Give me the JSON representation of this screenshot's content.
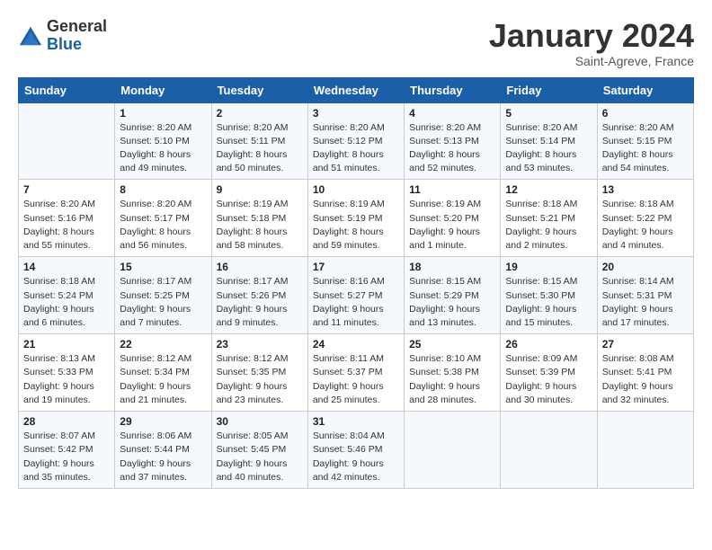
{
  "header": {
    "logo": {
      "general": "General",
      "blue": "Blue"
    },
    "title": "January 2024",
    "location": "Saint-Agreve, France"
  },
  "weekdays": [
    "Sunday",
    "Monday",
    "Tuesday",
    "Wednesday",
    "Thursday",
    "Friday",
    "Saturday"
  ],
  "weeks": [
    [
      {
        "day": null,
        "sunrise": null,
        "sunset": null,
        "daylight": null
      },
      {
        "day": "1",
        "sunrise": "Sunrise: 8:20 AM",
        "sunset": "Sunset: 5:10 PM",
        "daylight": "Daylight: 8 hours and 49 minutes."
      },
      {
        "day": "2",
        "sunrise": "Sunrise: 8:20 AM",
        "sunset": "Sunset: 5:11 PM",
        "daylight": "Daylight: 8 hours and 50 minutes."
      },
      {
        "day": "3",
        "sunrise": "Sunrise: 8:20 AM",
        "sunset": "Sunset: 5:12 PM",
        "daylight": "Daylight: 8 hours and 51 minutes."
      },
      {
        "day": "4",
        "sunrise": "Sunrise: 8:20 AM",
        "sunset": "Sunset: 5:13 PM",
        "daylight": "Daylight: 8 hours and 52 minutes."
      },
      {
        "day": "5",
        "sunrise": "Sunrise: 8:20 AM",
        "sunset": "Sunset: 5:14 PM",
        "daylight": "Daylight: 8 hours and 53 minutes."
      },
      {
        "day": "6",
        "sunrise": "Sunrise: 8:20 AM",
        "sunset": "Sunset: 5:15 PM",
        "daylight": "Daylight: 8 hours and 54 minutes."
      }
    ],
    [
      {
        "day": "7",
        "sunrise": "Sunrise: 8:20 AM",
        "sunset": "Sunset: 5:16 PM",
        "daylight": "Daylight: 8 hours and 55 minutes."
      },
      {
        "day": "8",
        "sunrise": "Sunrise: 8:20 AM",
        "sunset": "Sunset: 5:17 PM",
        "daylight": "Daylight: 8 hours and 56 minutes."
      },
      {
        "day": "9",
        "sunrise": "Sunrise: 8:19 AM",
        "sunset": "Sunset: 5:18 PM",
        "daylight": "Daylight: 8 hours and 58 minutes."
      },
      {
        "day": "10",
        "sunrise": "Sunrise: 8:19 AM",
        "sunset": "Sunset: 5:19 PM",
        "daylight": "Daylight: 8 hours and 59 minutes."
      },
      {
        "day": "11",
        "sunrise": "Sunrise: 8:19 AM",
        "sunset": "Sunset: 5:20 PM",
        "daylight": "Daylight: 9 hours and 1 minute."
      },
      {
        "day": "12",
        "sunrise": "Sunrise: 8:18 AM",
        "sunset": "Sunset: 5:21 PM",
        "daylight": "Daylight: 9 hours and 2 minutes."
      },
      {
        "day": "13",
        "sunrise": "Sunrise: 8:18 AM",
        "sunset": "Sunset: 5:22 PM",
        "daylight": "Daylight: 9 hours and 4 minutes."
      }
    ],
    [
      {
        "day": "14",
        "sunrise": "Sunrise: 8:18 AM",
        "sunset": "Sunset: 5:24 PM",
        "daylight": "Daylight: 9 hours and 6 minutes."
      },
      {
        "day": "15",
        "sunrise": "Sunrise: 8:17 AM",
        "sunset": "Sunset: 5:25 PM",
        "daylight": "Daylight: 9 hours and 7 minutes."
      },
      {
        "day": "16",
        "sunrise": "Sunrise: 8:17 AM",
        "sunset": "Sunset: 5:26 PM",
        "daylight": "Daylight: 9 hours and 9 minutes."
      },
      {
        "day": "17",
        "sunrise": "Sunrise: 8:16 AM",
        "sunset": "Sunset: 5:27 PM",
        "daylight": "Daylight: 9 hours and 11 minutes."
      },
      {
        "day": "18",
        "sunrise": "Sunrise: 8:15 AM",
        "sunset": "Sunset: 5:29 PM",
        "daylight": "Daylight: 9 hours and 13 minutes."
      },
      {
        "day": "19",
        "sunrise": "Sunrise: 8:15 AM",
        "sunset": "Sunset: 5:30 PM",
        "daylight": "Daylight: 9 hours and 15 minutes."
      },
      {
        "day": "20",
        "sunrise": "Sunrise: 8:14 AM",
        "sunset": "Sunset: 5:31 PM",
        "daylight": "Daylight: 9 hours and 17 minutes."
      }
    ],
    [
      {
        "day": "21",
        "sunrise": "Sunrise: 8:13 AM",
        "sunset": "Sunset: 5:33 PM",
        "daylight": "Daylight: 9 hours and 19 minutes."
      },
      {
        "day": "22",
        "sunrise": "Sunrise: 8:12 AM",
        "sunset": "Sunset: 5:34 PM",
        "daylight": "Daylight: 9 hours and 21 minutes."
      },
      {
        "day": "23",
        "sunrise": "Sunrise: 8:12 AM",
        "sunset": "Sunset: 5:35 PM",
        "daylight": "Daylight: 9 hours and 23 minutes."
      },
      {
        "day": "24",
        "sunrise": "Sunrise: 8:11 AM",
        "sunset": "Sunset: 5:37 PM",
        "daylight": "Daylight: 9 hours and 25 minutes."
      },
      {
        "day": "25",
        "sunrise": "Sunrise: 8:10 AM",
        "sunset": "Sunset: 5:38 PM",
        "daylight": "Daylight: 9 hours and 28 minutes."
      },
      {
        "day": "26",
        "sunrise": "Sunrise: 8:09 AM",
        "sunset": "Sunset: 5:39 PM",
        "daylight": "Daylight: 9 hours and 30 minutes."
      },
      {
        "day": "27",
        "sunrise": "Sunrise: 8:08 AM",
        "sunset": "Sunset: 5:41 PM",
        "daylight": "Daylight: 9 hours and 32 minutes."
      }
    ],
    [
      {
        "day": "28",
        "sunrise": "Sunrise: 8:07 AM",
        "sunset": "Sunset: 5:42 PM",
        "daylight": "Daylight: 9 hours and 35 minutes."
      },
      {
        "day": "29",
        "sunrise": "Sunrise: 8:06 AM",
        "sunset": "Sunset: 5:44 PM",
        "daylight": "Daylight: 9 hours and 37 minutes."
      },
      {
        "day": "30",
        "sunrise": "Sunrise: 8:05 AM",
        "sunset": "Sunset: 5:45 PM",
        "daylight": "Daylight: 9 hours and 40 minutes."
      },
      {
        "day": "31",
        "sunrise": "Sunrise: 8:04 AM",
        "sunset": "Sunset: 5:46 PM",
        "daylight": "Daylight: 9 hours and 42 minutes."
      },
      {
        "day": null,
        "sunrise": null,
        "sunset": null,
        "daylight": null
      },
      {
        "day": null,
        "sunrise": null,
        "sunset": null,
        "daylight": null
      },
      {
        "day": null,
        "sunrise": null,
        "sunset": null,
        "daylight": null
      }
    ]
  ]
}
